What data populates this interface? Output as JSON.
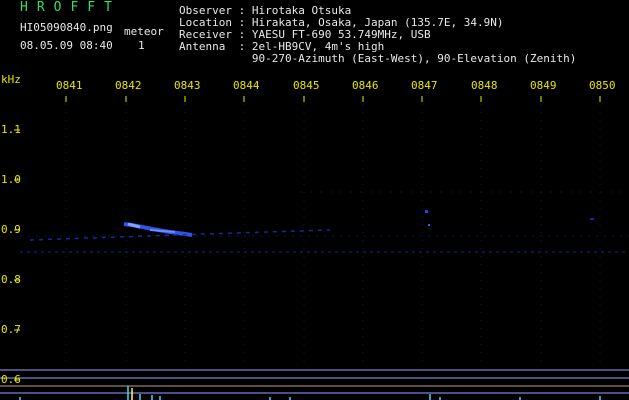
{
  "header": {
    "app_title": "HROFFT",
    "filename": "HI05090840.png",
    "date_time": "08.05.09 08:40",
    "meteor_label": "meteor",
    "meteor_count": "1",
    "observer_line": "Observer : Hirotaka Otsuka",
    "location_line": "Location : Hirakata, Osaka, Japan (135.7E, 34.9N)",
    "receiver_line": "Receiver : YAESU FT-690 53.749MHz, USB",
    "antenna_line": "Antenna  : 2el-HB9CV, 4m's high",
    "antenna_line2": "           90-270-Azimuth (East-West), 90-Elevation (Zenith)"
  },
  "axis": {
    "y_unit": "kHz",
    "y_ticks": [
      "1.1",
      "1.0",
      "0.9",
      "0.8",
      "0.7",
      "0.6"
    ],
    "x_ticks": [
      "0841",
      "0842",
      "0843",
      "0844",
      "0845",
      "0846",
      "0847",
      "0848",
      "0849",
      "0850"
    ]
  },
  "colors": {
    "title": "#33dd66",
    "labels": "#e6e600",
    "header_text": "#e8e8e8",
    "signal": "#3a5cff",
    "background": "#000000"
  }
}
